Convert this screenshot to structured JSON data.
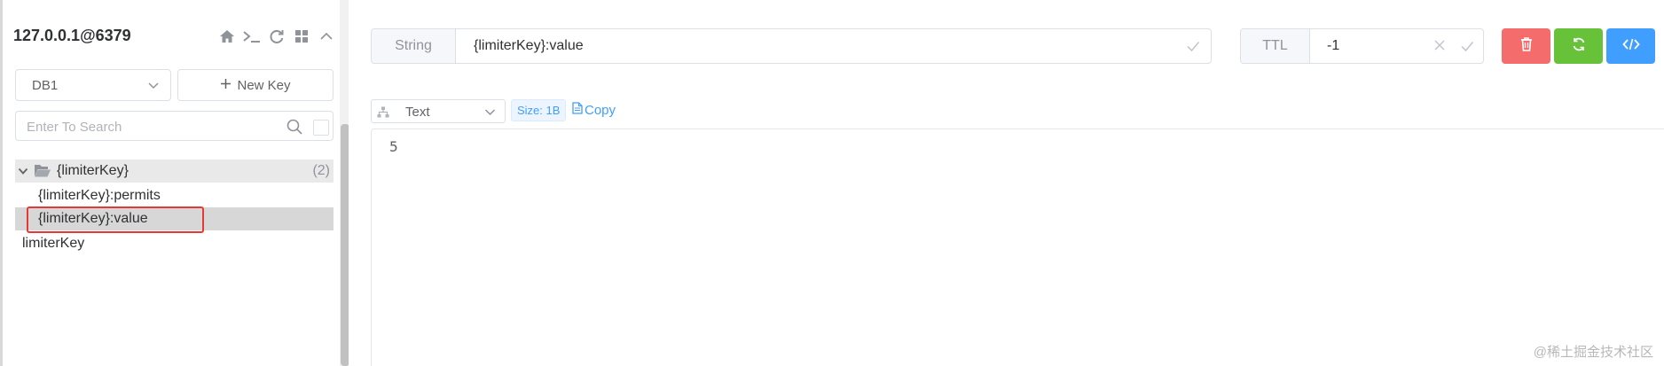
{
  "sidebar": {
    "connection_title": "127.0.0.1@6379",
    "icons": [
      "home-icon",
      "terminal-icon",
      "refresh-icon",
      "grid-icon",
      "chevron-up-icon"
    ],
    "db_select": {
      "value": "DB1"
    },
    "new_key_label": "New Key",
    "search": {
      "placeholder": "Enter To Search"
    },
    "tree": {
      "folder": {
        "name": "{limiterKey}",
        "count": "(2)",
        "expanded": true
      },
      "children": [
        {
          "name": "{limiterKey}:permits",
          "selected": false
        },
        {
          "name": "{limiterKey}:value",
          "selected": true
        }
      ],
      "root_items": [
        {
          "name": "limiterKey"
        }
      ]
    }
  },
  "main": {
    "key_type": "String",
    "key_name": "{limiterKey}:value",
    "ttl_label": "TTL",
    "ttl_value": "-1",
    "format": "Text",
    "size_tag": "Size: 1B",
    "copy_label": "Copy",
    "content": "5"
  },
  "watermark": "@稀土掘金技术社区",
  "colors": {
    "delete": "#f56c6c",
    "refresh": "#67c23a",
    "code": "#409eff",
    "highlight_box": "#e53935",
    "selected_row": "#d7d7d7",
    "folder_row": "#e9e9e9"
  }
}
